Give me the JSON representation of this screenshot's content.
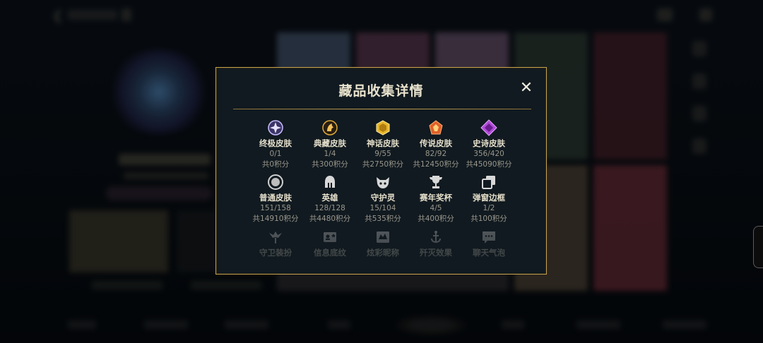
{
  "modal": {
    "title": "藏品收集详情",
    "close_label": "✕"
  },
  "collection": [
    {
      "name": "终极皮肤",
      "count": "0/1",
      "points": "共0积分",
      "icon": "ultimate-skin-icon",
      "color": "#b7a6ff"
    },
    {
      "name": "典藏皮肤",
      "count": "1/4",
      "points": "共300积分",
      "icon": "prestige-skin-icon",
      "color": "#e0a93a"
    },
    {
      "name": "神话皮肤",
      "count": "9/55",
      "points": "共2750积分",
      "icon": "mythic-skin-icon",
      "color": "#e8b52a"
    },
    {
      "name": "传说皮肤",
      "count": "82/92",
      "points": "共12450积分",
      "icon": "legendary-skin-icon",
      "color": "#e0602a"
    },
    {
      "name": "史诗皮肤",
      "count": "356/420",
      "points": "共45090积分",
      "icon": "epic-skin-icon",
      "color": "#b04ad8"
    },
    {
      "name": "普通皮肤",
      "count": "151/158",
      "points": "共14910积分",
      "icon": "common-skin-icon",
      "color": "#c9c9c9"
    },
    {
      "name": "英雄",
      "count": "128/128",
      "points": "共4480积分",
      "icon": "champion-helmet-icon",
      "color": "#d8d8d8"
    },
    {
      "name": "守护灵",
      "count": "15/104",
      "points": "共535积分",
      "icon": "guardian-icon",
      "color": "#d8d8d8"
    },
    {
      "name": "赛年奖杯",
      "count": "4/5",
      "points": "共400积分",
      "icon": "trophy-icon",
      "color": "#d8d8d8"
    },
    {
      "name": "弹窗边框",
      "count": "1/2",
      "points": "共100积分",
      "icon": "popup-frame-icon",
      "color": "#d8d8d8"
    },
    {
      "name": "守卫装扮",
      "icon": "ward-skin-icon",
      "color": "#d8d8d8"
    },
    {
      "name": "信息底纹",
      "icon": "profile-banner-icon",
      "color": "#d8d8d8"
    },
    {
      "name": "炫彩昵称",
      "icon": "chroma-name-icon",
      "color": "#d8d8d8"
    },
    {
      "name": "歼灭效果",
      "icon": "kill-effect-icon",
      "color": "#d8d8d8"
    },
    {
      "name": "聊天气泡",
      "icon": "chat-bubble-icon",
      "color": "#d8d8d8"
    }
  ],
  "colors": {
    "modal_border": "#c5a14f",
    "modal_bg": "#111a20",
    "title": "#e8e2cd",
    "subtext": "#9a978c"
  }
}
